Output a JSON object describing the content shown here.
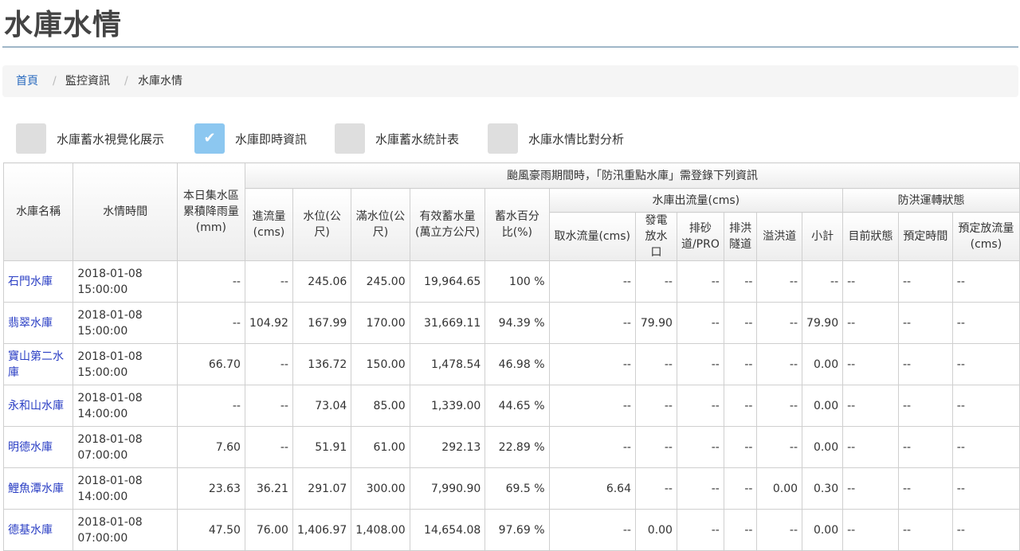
{
  "page": {
    "title": "水庫水情"
  },
  "breadcrumb": {
    "items": [
      "首頁",
      "監控資訊",
      "水庫水情"
    ],
    "separator": "/"
  },
  "tabs": [
    {
      "label": "水庫蓄水視覺化展示",
      "checked": false
    },
    {
      "label": "水庫即時資訊",
      "checked": true,
      "check_glyph": "✔"
    },
    {
      "label": "水庫蓄水統計表",
      "checked": false
    },
    {
      "label": "水庫水情比對分析",
      "checked": false
    }
  ],
  "table": {
    "headers": {
      "name": "水庫名稱",
      "time": "水情時間",
      "rain": "本日集水區累積降雨量(mm)",
      "typhoon_group": "颱風豪雨期間時，「防汛重點水庫」需登錄下列資訊",
      "inflow": "進流量(cms)",
      "level": "水位(公尺)",
      "full_level": "滿水位(公尺)",
      "storage": "有效蓄水量(萬立方公尺)",
      "percent": "蓄水百分比(%)",
      "outflow_group": "水庫出流量(cms)",
      "intake": "取水流量(cms)",
      "power": "發電放水口",
      "sand": "排砂道/PRO",
      "flood_tunnel": "排洪隧道",
      "spillway": "溢洪道",
      "subtotal": "小計",
      "ops_group": "防洪運轉狀態",
      "current_status": "目前狀態",
      "scheduled_time": "預定時間",
      "scheduled_discharge": "預定放流量(cms)"
    },
    "rows": [
      {
        "name": "石門水庫",
        "date": "2018-01-08",
        "clock": "15:00:00",
        "rain": "--",
        "inflow": "--",
        "level": "245.06",
        "full": "245.00",
        "storage": "19,964.65",
        "percent": "100 %",
        "intake": "--",
        "power": "--",
        "sand": "--",
        "tunnel": "--",
        "spill": "--",
        "subtotal": "--",
        "status": "--",
        "sched_time": "--",
        "sched_flow": "--"
      },
      {
        "name": "翡翠水庫",
        "date": "2018-01-08",
        "clock": "15:00:00",
        "rain": "--",
        "inflow": "104.92",
        "level": "167.99",
        "full": "170.00",
        "storage": "31,669.11",
        "percent": "94.39 %",
        "intake": "--",
        "power": "79.90",
        "sand": "--",
        "tunnel": "--",
        "spill": "--",
        "subtotal": "79.90",
        "status": "--",
        "sched_time": "--",
        "sched_flow": "--"
      },
      {
        "name": "寶山第二水庫",
        "date": "2018-01-08",
        "clock": "15:00:00",
        "rain": "66.70",
        "inflow": "--",
        "level": "136.72",
        "full": "150.00",
        "storage": "1,478.54",
        "percent": "46.98 %",
        "intake": "--",
        "power": "--",
        "sand": "--",
        "tunnel": "--",
        "spill": "--",
        "subtotal": "0.00",
        "status": "--",
        "sched_time": "--",
        "sched_flow": "--"
      },
      {
        "name": "永和山水庫",
        "date": "2018-01-08",
        "clock": "14:00:00",
        "rain": "--",
        "inflow": "--",
        "level": "73.04",
        "full": "85.00",
        "storage": "1,339.00",
        "percent": "44.65 %",
        "intake": "--",
        "power": "--",
        "sand": "--",
        "tunnel": "--",
        "spill": "--",
        "subtotal": "0.00",
        "status": "--",
        "sched_time": "--",
        "sched_flow": "--"
      },
      {
        "name": "明德水庫",
        "date": "2018-01-08",
        "clock": "07:00:00",
        "rain": "7.60",
        "inflow": "--",
        "level": "51.91",
        "full": "61.00",
        "storage": "292.13",
        "percent": "22.89 %",
        "intake": "--",
        "power": "--",
        "sand": "--",
        "tunnel": "--",
        "spill": "--",
        "subtotal": "0.00",
        "status": "--",
        "sched_time": "--",
        "sched_flow": "--"
      },
      {
        "name": "鯉魚潭水庫",
        "date": "2018-01-08",
        "clock": "14:00:00",
        "rain": "23.63",
        "inflow": "36.21",
        "level": "291.07",
        "full": "300.00",
        "storage": "7,990.90",
        "percent": "69.5 %",
        "intake": "6.64",
        "power": "--",
        "sand": "--",
        "tunnel": "--",
        "spill": "0.00",
        "subtotal": "0.30",
        "status": "--",
        "sched_time": "--",
        "sched_flow": "--"
      },
      {
        "name": "德基水庫",
        "date": "2018-01-08",
        "clock": "07:00:00",
        "rain": "47.50",
        "inflow": "76.00",
        "level": "1,406.97",
        "full": "1,408.00",
        "storage": "14,654.08",
        "percent": "97.69 %",
        "intake": "--",
        "power": "0.00",
        "sand": "--",
        "tunnel": "--",
        "spill": "--",
        "subtotal": "0.00",
        "status": "--",
        "sched_time": "--",
        "sched_flow": "--"
      }
    ]
  },
  "colors": {
    "link": "#2a6bbf",
    "reservoir_link": "#2a3ec4",
    "tab_checked": "#8cc7f0",
    "tab_unchecked": "#dedede"
  }
}
